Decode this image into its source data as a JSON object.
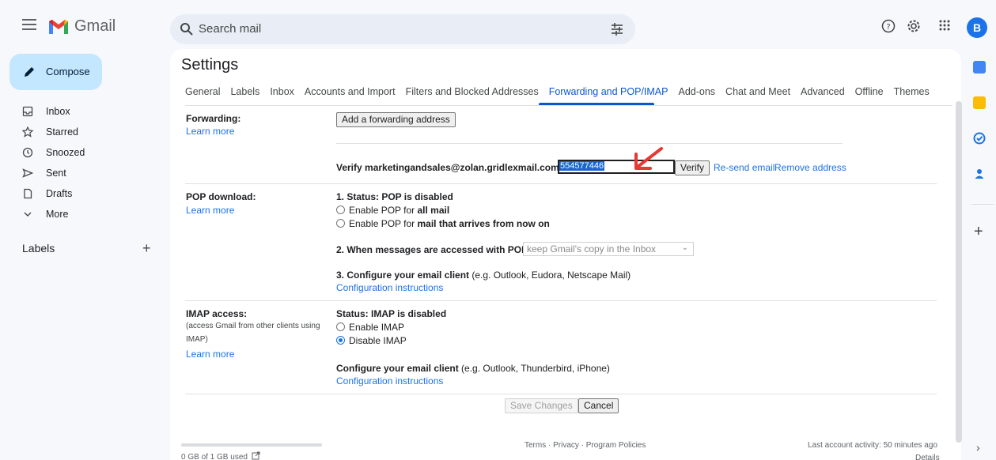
{
  "app": {
    "name": "Gmail",
    "avatar_letter": "B"
  },
  "search": {
    "placeholder": "Search mail"
  },
  "compose": {
    "label": "Compose"
  },
  "nav": {
    "items": [
      {
        "label": "Inbox",
        "icon": "inbox-icon"
      },
      {
        "label": "Starred",
        "icon": "star-icon"
      },
      {
        "label": "Snoozed",
        "icon": "clock-icon"
      },
      {
        "label": "Sent",
        "icon": "send-icon"
      },
      {
        "label": "Drafts",
        "icon": "draft-icon"
      },
      {
        "label": "More",
        "icon": "chevron-down-icon"
      }
    ],
    "labels_heading": "Labels",
    "labels_add": "+"
  },
  "settings": {
    "title": "Settings",
    "tabs": [
      "General",
      "Labels",
      "Inbox",
      "Accounts and Import",
      "Filters and Blocked Addresses",
      "Forwarding and POP/IMAP",
      "Add-ons",
      "Chat and Meet",
      "Advanced",
      "Offline",
      "Themes"
    ],
    "active_tab": "Forwarding and POP/IMAP"
  },
  "forwarding": {
    "label": "Forwarding:",
    "learn_more": "Learn more",
    "add_button": "Add a forwarding address",
    "verify_text": "Verify marketingandsales@zolan.gridlexmail.com",
    "code_value": "554577446",
    "verify_button": "Verify",
    "resend_link": "Re-send email",
    "remove_link": "Remove address"
  },
  "pop": {
    "label": "POP download:",
    "learn_more": "Learn more",
    "status": "1. Status: POP is disabled",
    "option1_prefix": "Enable POP for ",
    "option1_bold": "all mail",
    "option2_prefix": "Enable POP for ",
    "option2_bold": "mail that arrives from now on",
    "step2": "2. When messages are accessed with POP",
    "step2_select": "keep Gmail's copy in the Inbox",
    "step3_bold": "3. Configure your email client",
    "step3_rest": " (e.g. Outlook, Eudora, Netscape Mail)",
    "config_link": "Configuration instructions"
  },
  "imap": {
    "label": "IMAP access:",
    "note": "(access Gmail from other clients using IMAP)",
    "learn_more": "Learn more",
    "status": "Status: IMAP is disabled",
    "enable": "Enable IMAP",
    "disable": "Disable IMAP",
    "selected": "Disable IMAP",
    "configure_bold": "Configure your email client",
    "configure_rest": " (e.g. Outlook, Thunderbird, iPhone)",
    "config_link": "Configuration instructions"
  },
  "actions": {
    "save": "Save Changes",
    "cancel": "Cancel"
  },
  "footer": {
    "storage": "0 GB of 1 GB used",
    "links": "Terms · Privacy · Program Policies",
    "activity": "Last account activity: 50 minutes ago",
    "details": "Details"
  },
  "colors": {
    "accent": "#0b57d0",
    "compose_bg": "#c2e7ff",
    "annotation_arrow": "#e53935"
  }
}
